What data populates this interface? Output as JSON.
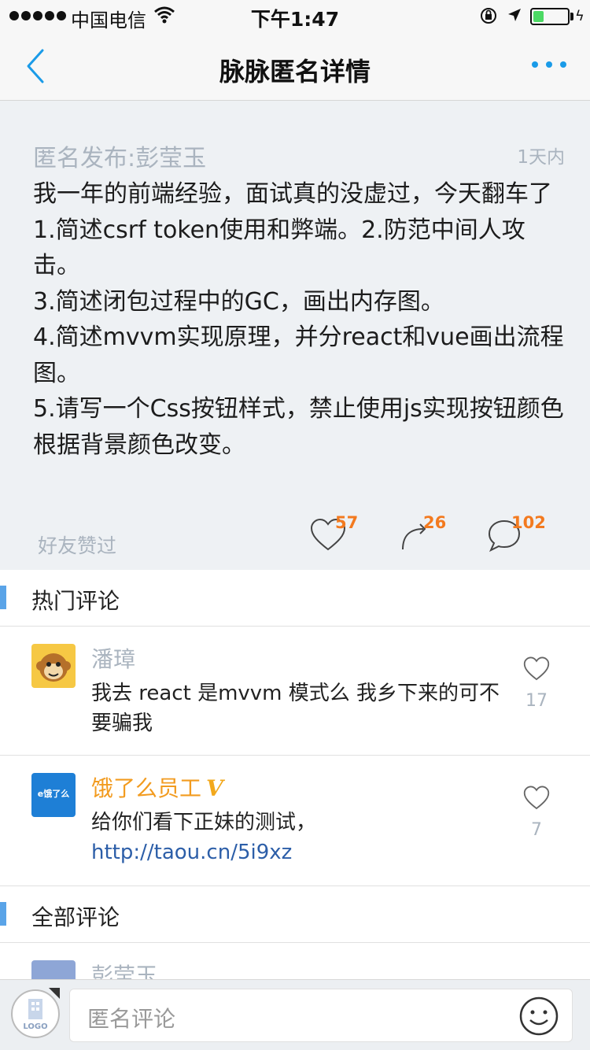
{
  "status": {
    "carrier": "中国电信",
    "time": "下午1:47",
    "battery_level": 0.3
  },
  "nav": {
    "title": "脉脉匿名详情"
  },
  "post": {
    "author": "匿名发布:彭莹玉",
    "time": "1天内",
    "content": "我一年的前端经验，面试真的没虚过，今天翻车了\n1.简述csrf token使用和弊端。2.防范中间人攻击。\n3.简述闭包过程中的GC，画出内存图。\n4.简述mvvm实现原理，并分react和vue画出流程图。\n5.请写一个Css按钮样式，禁止使用js实现按钮颜色根据背景颜色改变。",
    "friends_liked": "好友赞过",
    "likes": "57",
    "reposts": "26",
    "comments": "102"
  },
  "hot_comments": {
    "title": "热门评论",
    "items": [
      {
        "name": "潘璋",
        "text": "我去 react 是mvvm 模式么 我乡下来的可不要骗我",
        "likes": "17"
      },
      {
        "name": "饿了么员工",
        "badge": "V",
        "text": "给你们看下正妹的测试，",
        "link": "http://taou.cn/5i9xz",
        "likes": "7",
        "avatar_text": "e饿了么"
      }
    ]
  },
  "all_comments": {
    "title": "全部评论",
    "first_name": "彭莹玉"
  },
  "bottom": {
    "logo_label": "LOGO",
    "placeholder": "匿名评论"
  },
  "colors": {
    "accent": "#1a9be8",
    "count_orange": "#f37a1f",
    "vip_orange": "#f29b1f",
    "link_blue": "#2c5ea8"
  }
}
